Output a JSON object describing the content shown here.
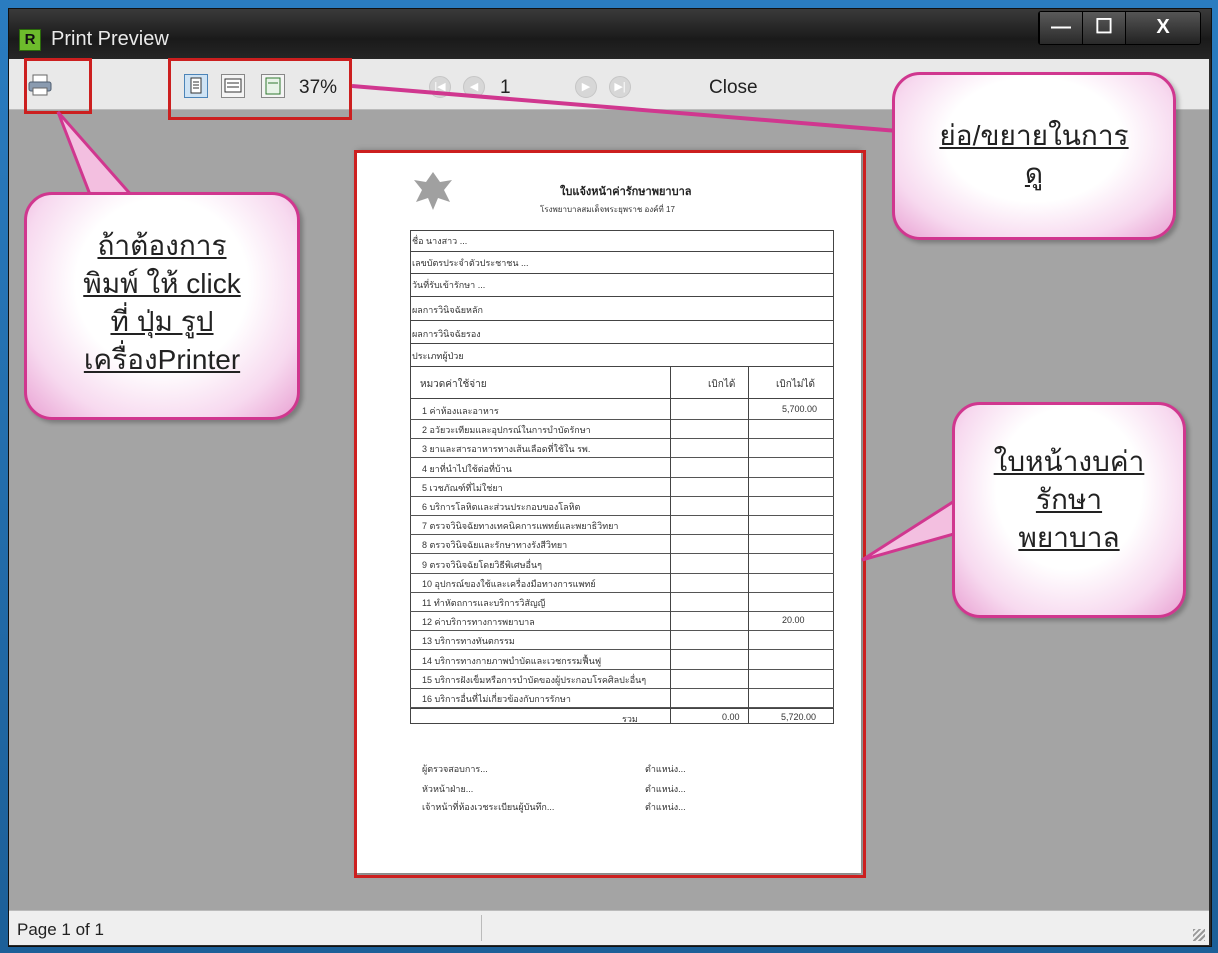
{
  "window": {
    "title": "Print Preview",
    "app_icon": "R",
    "minimize": "—",
    "maximize": "☐",
    "close": "X"
  },
  "toolbar": {
    "zoom": "37%",
    "page": "1",
    "close_label": "Close"
  },
  "status": {
    "text": "Page 1 of 1"
  },
  "callouts": {
    "print": [
      "ถ้าต้องการ",
      "พิมพ์ ให้ click",
      "ที่ ปุ่ม รูป",
      "เครื่องPrinter"
    ],
    "zoom": [
      "ย่อ/ขยายในการ",
      "ดู"
    ],
    "page": [
      "ใบหน้างบค่า",
      "รักษา",
      "พยาบาล"
    ]
  },
  "document": {
    "title": "ใบแจ้งหน้าค่ารักษาพยาบาล",
    "subtitle": "โรงพยาบาลสมเด็จพระยุพราช องค์ที่ 17",
    "row_headers": [
      "ชื่อ นางสาว ...",
      "เลขบัตรประจำตัวประชาชน ...",
      "วันที่รับเข้ารักษา ...",
      "ผลการวินิจฉัยหลัก",
      "ผลการวินิจฉัยรอง",
      "ประเภทผู้ป่วย"
    ],
    "table_header": [
      "หมวดค่าใช้จ่าย",
      "เบิกได้",
      "เบิกไม่ได้"
    ],
    "items": [
      "1 ค่าห้องและอาหาร",
      "2 อวัยวะเทียมและอุปกรณ์ในการบำบัดรักษา",
      "3 ยาและสารอาหารทางเส้นเลือดที่ใช้ใน รพ.",
      "4 ยาที่นำไปใช้ต่อที่บ้าน",
      "5 เวชภัณฑ์ที่ไม่ใช่ยา",
      "6 บริการโลหิตและส่วนประกอบของโลหิต",
      "7 ตรวจวินิจฉัยทางเทคนิคการแพทย์และพยาธิวิทยา",
      "8 ตรวจวินิจฉัยและรักษาทางรังสีวิทยา",
      "9 ตรวจวินิจฉัยโดยวิธีพิเศษอื่นๆ",
      "10 อุปกรณ์ของใช้และเครื่องมือทางการแพทย์",
      "11 ทำหัตถการและบริการวิสัญญี",
      "12 ค่าบริการทางการพยาบาล",
      "13 บริการทางทันตกรรม",
      "14 บริการทางกายภาพบำบัดและเวชกรรมฟื้นฟู",
      "15 บริการฝังเข็มหรือการบำบัดของผู้ประกอบโรคศิลปะอื่นๆ",
      "16 บริการอื่นที่ไม่เกี่ยวข้องกับการรักษา"
    ],
    "total_label": "รวม",
    "total_values": [
      "0.00",
      "5,720.00"
    ],
    "amounts": {
      "1": "5,700.00",
      "12": "20.00"
    },
    "signatures": [
      "ผู้ตรวจสอบการ...",
      "ตำแหน่ง...",
      "หัวหน้าฝ่าย...",
      "ตำแหน่ง...",
      "เจ้าหน้าที่ห้องเวชระเบียนผู้บันทึก...",
      "ตำแหน่ง..."
    ]
  },
  "colors": {
    "callout_border": "#d0378f",
    "highlight_box": "#cc1f1f",
    "preview_bg": "#a4a4a4"
  }
}
